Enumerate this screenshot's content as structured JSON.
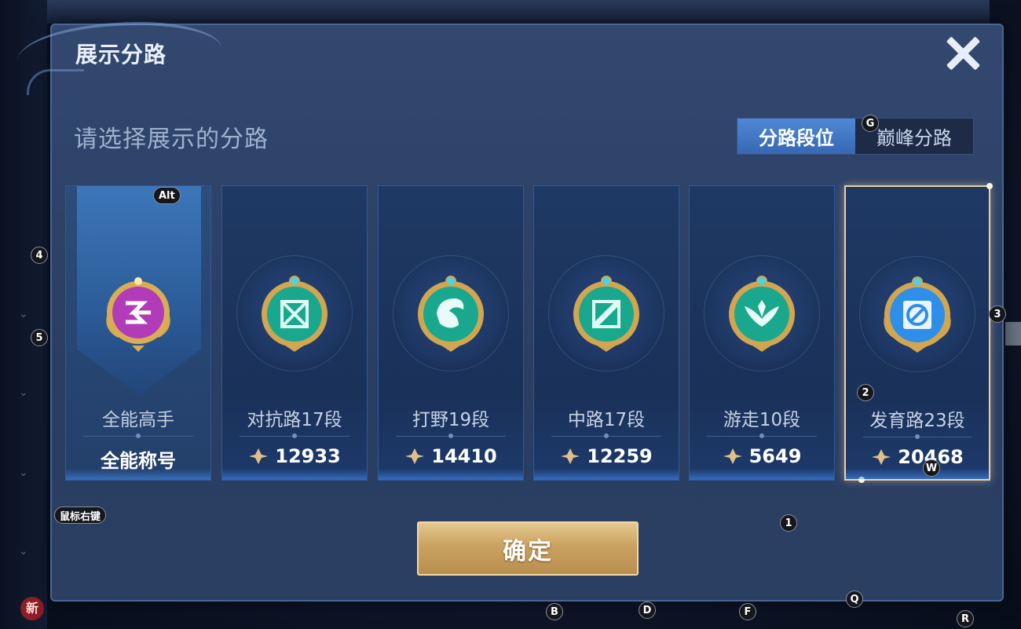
{
  "modal": {
    "title": "展示分路",
    "subtitle": "请选择展示的分路",
    "close_icon": "close-icon"
  },
  "tabs": [
    {
      "label": "分路段位",
      "active": true
    },
    {
      "label": "巅峰分路",
      "active": false
    }
  ],
  "cards": [
    {
      "label": "全能高手",
      "value": "全能称号",
      "icon": "all-round-emblem-icon",
      "emblem_color": "#c23cc9"
    },
    {
      "label": "对抗路17段",
      "value": "12933",
      "icon": "clash-lane-emblem-icon",
      "emblem_color": "#1fb59a"
    },
    {
      "label": "打野19段",
      "value": "14410",
      "icon": "jungle-emblem-icon",
      "emblem_color": "#1fb59a"
    },
    {
      "label": "中路17段",
      "value": "12259",
      "icon": "mid-lane-emblem-icon",
      "emblem_color": "#1fb59a"
    },
    {
      "label": "游走10段",
      "value": "5649",
      "icon": "roam-emblem-icon",
      "emblem_color": "#1fb59a"
    },
    {
      "label": "发育路23段",
      "value": "20468",
      "icon": "farm-lane-emblem-icon",
      "emblem_color": "#2f8ee8",
      "selected": true
    }
  ],
  "confirm_label": "确定",
  "hotkeys": {
    "alt": "Alt",
    "g": "G",
    "w": "W",
    "right_click": "鼠标右键",
    "n1": "1",
    "n2": "2",
    "n3": "3",
    "n4": "4",
    "n5": "5",
    "b": "B",
    "d": "D",
    "f": "F",
    "q": "Q",
    "r": "R"
  },
  "background": {
    "new_badge": "新"
  },
  "colors": {
    "accent_blue": "#3768b2",
    "gold": "#c9a160",
    "selected_border": "#f1cf9d"
  }
}
